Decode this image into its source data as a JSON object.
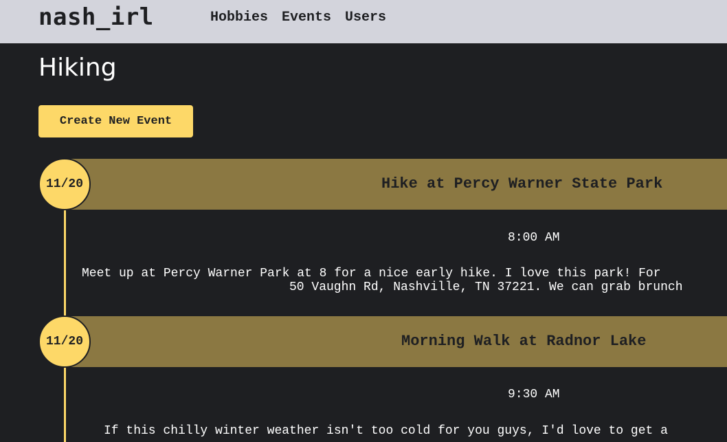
{
  "nav": {
    "brand": "nash_irl",
    "links": [
      "Hobbies",
      "Events",
      "Users"
    ]
  },
  "page": {
    "title": "Hiking",
    "create_button": "Create New Event"
  },
  "events": [
    {
      "date": "11/20",
      "title": "Hike at Percy Warner State Park",
      "time": "8:00 AM",
      "description_lines": [
        "Meet up at Percy Warner Park at 8 for a nice early hike. I love this park! For",
        "50 Vaughn Rd, Nashville, TN 37221. We can grab brunch"
      ]
    },
    {
      "date": "11/20",
      "title": "Morning Walk at Radnor Lake",
      "time": "9:30 AM",
      "description_lines": [
        "If this chilly winter weather isn't too cold for you guys, I'd love to get a"
      ]
    }
  ],
  "colors": {
    "background": "#1e1f22",
    "navbar": "#d3d4dc",
    "accent": "#fdd868",
    "event_header": "#8b7842"
  }
}
